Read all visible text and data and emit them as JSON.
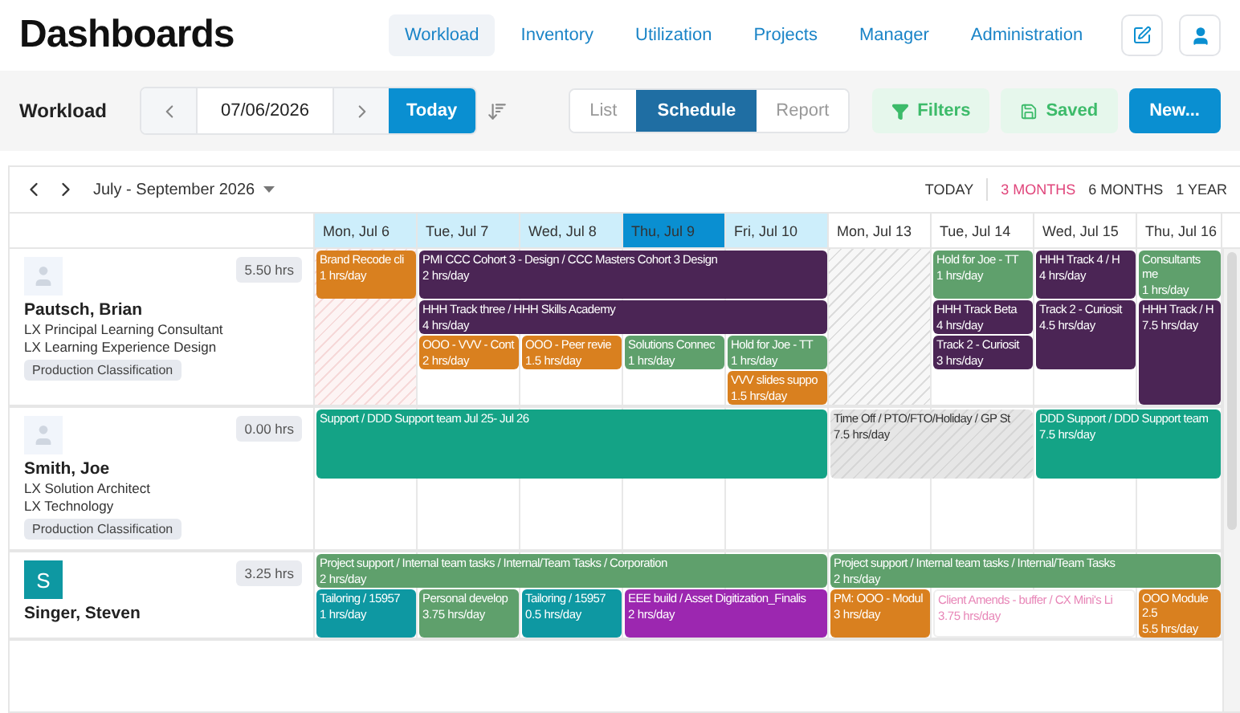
{
  "logo": "Dashboards",
  "nav": [
    {
      "label": "Workload",
      "selected": true
    },
    {
      "label": "Inventory",
      "selected": false
    },
    {
      "label": "Utilization",
      "selected": false
    },
    {
      "label": "Projects",
      "selected": false
    },
    {
      "label": "Manager",
      "selected": false
    },
    {
      "label": "Administration",
      "selected": false
    }
  ],
  "toolbar": {
    "title": "Workload",
    "date": "07/06/2026",
    "today": "Today",
    "views": [
      {
        "label": "List",
        "selected": false
      },
      {
        "label": "Schedule",
        "selected": true
      },
      {
        "label": "Report",
        "selected": false
      }
    ],
    "filters": "Filters",
    "saved": "Saved",
    "new": "New..."
  },
  "calendar": {
    "range": "July - September 2026",
    "today_link": "TODAY",
    "spans": [
      {
        "label": "3 MONTHS",
        "selected": true
      },
      {
        "label": "6 MONTHS",
        "selected": false
      },
      {
        "label": "1 YEAR",
        "selected": false
      }
    ],
    "days": [
      {
        "label": "Mon, Jul 6",
        "current_week": true,
        "selected": false
      },
      {
        "label": "Tue, Jul 7",
        "current_week": true,
        "selected": false
      },
      {
        "label": "Wed, Jul 8",
        "current_week": true,
        "selected": false
      },
      {
        "label": "Thu, Jul 9",
        "current_week": true,
        "selected": true
      },
      {
        "label": "Fri, Jul 10",
        "current_week": true,
        "selected": false
      },
      {
        "label": "Mon, Jul 13",
        "current_week": false,
        "selected": false
      },
      {
        "label": "Tue, Jul 14",
        "current_week": false,
        "selected": false
      },
      {
        "label": "Wed, Jul 15",
        "current_week": false,
        "selected": false
      },
      {
        "label": "Thu, Jul 16",
        "current_week": false,
        "selected": false
      }
    ]
  },
  "people": [
    {
      "name": "Pautsch, Brian",
      "title": "LX Principal Learning Consultant",
      "department": "LX Learning Experience Design",
      "tag": "Production Classification",
      "hours": "5.50 hrs",
      "avatar": {
        "kind": "placeholder"
      },
      "days": [
        {
          "holiday": true,
          "unavailable": false
        },
        {
          "holiday": false,
          "unavailable": false
        },
        {
          "holiday": false,
          "unavailable": false
        },
        {
          "holiday": false,
          "unavailable": false
        },
        {
          "holiday": false,
          "unavailable": false
        },
        {
          "holiday": false,
          "unavailable": true
        },
        {
          "holiday": false,
          "unavailable": false
        },
        {
          "holiday": false,
          "unavailable": false
        },
        {
          "holiday": false,
          "unavailable": false
        }
      ],
      "lanes": [
        [
          {
            "kind": "event",
            "title": "Brand Recode cli",
            "hours": "1 hrs/day",
            "color": "#d9801f"
          },
          {
            "kind": "event",
            "title": "PMI CCC Cohort 3 - Design / CCC Masters Cohort 3 Design",
            "hours": "2 hrs/day",
            "color": "#4b2555"
          },
          {
            "kind": "continued"
          },
          {
            "kind": "continued"
          },
          {
            "kind": "continued"
          },
          {
            "kind": "empty"
          },
          {
            "kind": "event",
            "title": "Hold for Joe - TT",
            "hours": "1 hrs/day",
            "color": "#5fa06c"
          },
          {
            "kind": "event",
            "title": "HHH Track 4 / H",
            "hours": "4 hrs/day",
            "color": "#4b2555"
          },
          {
            "kind": "event",
            "title": "Consultants me",
            "hours": "1 hrs/day",
            "color": "#5fa06c"
          }
        ],
        [
          {
            "kind": "empty"
          },
          {
            "kind": "event",
            "title": "HHH Track three / HHH Skills Academy",
            "hours": "4 hrs/day",
            "color": "#4b2555"
          },
          {
            "kind": "continued"
          },
          {
            "kind": "continued"
          },
          {
            "kind": "continued"
          },
          {
            "kind": "empty"
          },
          {
            "kind": "event",
            "title": "HHH Track Beta",
            "hours": "4 hrs/day",
            "color": "#4b2555"
          },
          {
            "kind": "event",
            "title": "Track 2 - Curiosit",
            "hours": "4.5 hrs/day",
            "color": "#4b2555"
          },
          {
            "kind": "event",
            "title": "HHH Track / H",
            "hours": "7.5 hrs/day",
            "color": "#4b2555"
          }
        ],
        [
          {
            "kind": "empty"
          },
          {
            "kind": "event",
            "title": "OOO - VVV - Cont",
            "hours": "2 hrs/day",
            "color": "#d9801f"
          },
          {
            "kind": "event",
            "title": "OOO - Peer revie",
            "hours": "1.5 hrs/day",
            "color": "#d9801f"
          },
          {
            "kind": "event",
            "title": "Solutions Connec",
            "hours": "1 hrs/day",
            "color": "#5fa06c"
          },
          {
            "kind": "event",
            "title": "Hold for Joe - TT",
            "hours": "1 hrs/day",
            "color": "#5fa06c"
          },
          {
            "kind": "empty"
          },
          {
            "kind": "event",
            "title": "Track 2 - Curiosit",
            "hours": "3 hrs/day",
            "color": "#4b2555"
          },
          {
            "kind": "covered"
          },
          {
            "kind": "covered"
          }
        ],
        [
          {
            "kind": "empty"
          },
          {
            "kind": "empty"
          },
          {
            "kind": "empty"
          },
          {
            "kind": "empty"
          },
          {
            "kind": "event",
            "title": "VVV slides suppo",
            "hours": "1.5 hrs/day",
            "color": "#d9801f"
          },
          {
            "kind": "empty"
          },
          {
            "kind": "empty"
          },
          {
            "kind": "empty"
          },
          {
            "kind": "covered"
          }
        ]
      ]
    },
    {
      "name": "Smith, Joe",
      "title": "LX Solution Architect",
      "department": "LX Technology",
      "tag": "Production Classification",
      "hours": "0.00 hrs",
      "avatar": {
        "kind": "placeholder"
      },
      "days": [
        {
          "holiday": false,
          "unavailable": false
        },
        {
          "holiday": false,
          "unavailable": false
        },
        {
          "holiday": false,
          "unavailable": false
        },
        {
          "holiday": false,
          "unavailable": false
        },
        {
          "holiday": false,
          "unavailable": false
        },
        {
          "holiday": false,
          "unavailable": false
        },
        {
          "holiday": false,
          "unavailable": false
        },
        {
          "holiday": false,
          "unavailable": false
        },
        {
          "holiday": false,
          "unavailable": false
        }
      ],
      "lanes": [
        [
          {
            "kind": "event",
            "title": "Support / DDD Support team Jul 25- Jul 26",
            "color": "#14a386"
          },
          {
            "kind": "continued"
          },
          {
            "kind": "continued"
          },
          {
            "kind": "continued"
          },
          {
            "kind": "continued"
          },
          {
            "kind": "time_off",
            "title": "Time Off / PTO/FTO/Holiday / GP St",
            "hours": "7.5 hrs/day",
            "color": "#e6e6e6"
          },
          {
            "kind": "continued"
          },
          {
            "kind": "event",
            "title": "DDD Support / DDD Support team",
            "hours": "7.5 hrs/day",
            "color": "#14a386"
          },
          {
            "kind": "continued"
          }
        ],
        [
          {
            "kind": "covered"
          },
          {
            "kind": "covered"
          },
          {
            "kind": "covered"
          },
          {
            "kind": "covered"
          },
          {
            "kind": "covered"
          },
          {
            "kind": "covered"
          },
          {
            "kind": "covered"
          },
          {
            "kind": "covered"
          },
          {
            "kind": "covered"
          }
        ]
      ]
    },
    {
      "name": "Singer, Steven",
      "hours": "3.25 hrs",
      "avatar": {
        "kind": "initial",
        "initial": "S"
      },
      "days": [
        {
          "holiday": false,
          "unavailable": false
        },
        {
          "holiday": false,
          "unavailable": false
        },
        {
          "holiday": false,
          "unavailable": false
        },
        {
          "holiday": false,
          "unavailable": false
        },
        {
          "holiday": false,
          "unavailable": false
        },
        {
          "holiday": false,
          "unavailable": false
        },
        {
          "holiday": false,
          "unavailable": false
        },
        {
          "holiday": false,
          "unavailable": false
        },
        {
          "holiday": false,
          "unavailable": false
        }
      ],
      "lanes": [
        [
          {
            "kind": "event",
            "title": "Project support / Internal team tasks / Internal/Team Tasks / Corporation",
            "hours": "2 hrs/day",
            "color": "#5fa06c"
          },
          {
            "kind": "continued"
          },
          {
            "kind": "continued"
          },
          {
            "kind": "continued"
          },
          {
            "kind": "continued"
          },
          {
            "kind": "event",
            "title": "Project support / Internal team tasks / Internal/Team Tasks",
            "hours": "2 hrs/day",
            "color": "#5fa06c"
          },
          {
            "kind": "continued"
          },
          {
            "kind": "continued"
          },
          {
            "kind": "continued"
          }
        ],
        [
          {
            "kind": "event",
            "title": "Tailoring / 15957",
            "hours": "1 hrs/day",
            "color": "#0e98a2"
          },
          {
            "kind": "event",
            "title": "Personal develop",
            "hours": "3.75 hrs/day",
            "color": "#5fa06c"
          },
          {
            "kind": "event",
            "title": "Tailoring / 15957",
            "hours": "0.5 hrs/day",
            "color": "#0e98a2"
          },
          {
            "kind": "event",
            "title": "EEE build / Asset Digitization_Finalis",
            "hours": "2 hrs/day",
            "color": "#9c27b0"
          },
          {
            "kind": "continued"
          },
          {
            "kind": "event",
            "title": "PM: OOO - Modul",
            "hours": "3 hrs/day",
            "color": "#d9801f"
          },
          {
            "kind": "tentative",
            "title": "Client Amends - buffer / CX Mini's Li",
            "hours": "3.75 hrs/day",
            "color": "#e887b8"
          },
          {
            "kind": "continued"
          },
          {
            "kind": "event",
            "title": "OOO Module 2.5",
            "hours": "5.5 hrs/day",
            "color": "#d9801f"
          }
        ]
      ]
    }
  ]
}
